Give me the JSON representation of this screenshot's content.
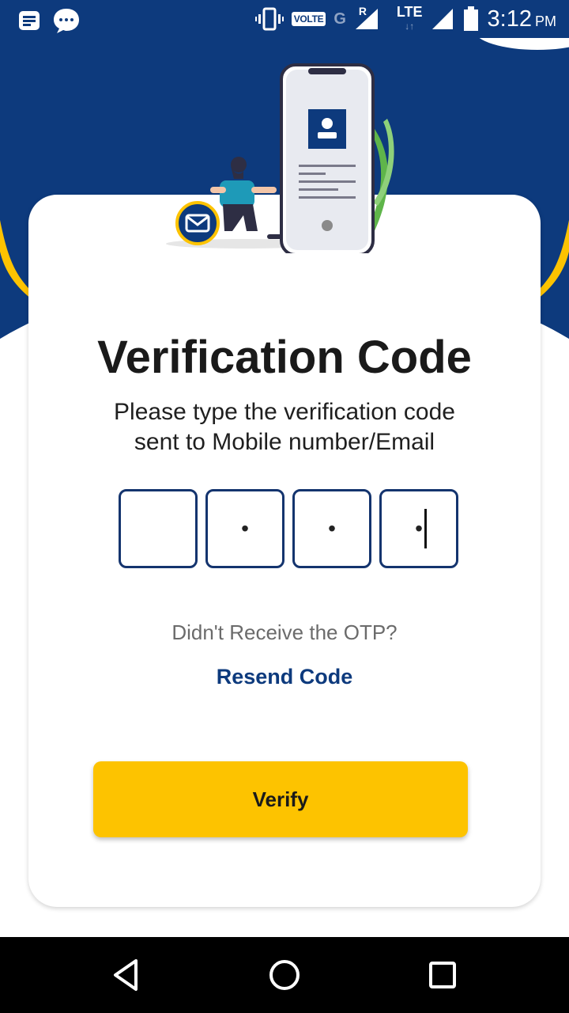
{
  "status_bar": {
    "left_icons": [
      "notes-icon",
      "chat-bubble-icon"
    ],
    "right_icons": [
      "vibrate-icon",
      "signal-icon",
      "battery-icon"
    ],
    "volte": "VOLTE",
    "network_g": "G",
    "roaming": "R",
    "lte": "LTE",
    "time": "3:12",
    "ampm": "PM"
  },
  "header": {
    "background_color": "#0d3a7d",
    "accent_color": "#fdc300"
  },
  "card": {
    "title": "Verification Code",
    "subtitle_line1": "Please type the verification code",
    "subtitle_line2": "sent to Mobile number/Email",
    "otp": {
      "boxes": [
        "",
        "•",
        "•",
        "•"
      ],
      "focused_index": 3
    },
    "didnt_receive": "Didn't Receive the OTP?",
    "resend_label": "Resend Code",
    "verify_label": "Verify"
  },
  "nav_bar": {
    "icons": [
      "back-icon",
      "home-icon",
      "recents-icon"
    ]
  }
}
